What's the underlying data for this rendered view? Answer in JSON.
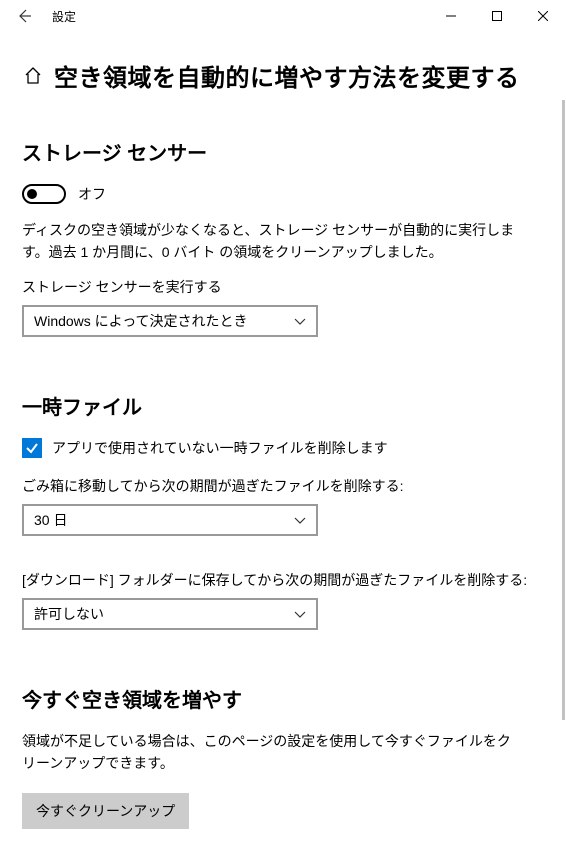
{
  "titlebar": {
    "title": "設定"
  },
  "page": {
    "title": "空き領域を自動的に増やす方法を変更する"
  },
  "storage_sense": {
    "heading": "ストレージ センサー",
    "toggle_label": "オフ",
    "description": "ディスクの空き領域が少なくなると、ストレージ センサーが自動的に実行します。過去 1 か月間に、0 バイト の領域をクリーンアップしました。",
    "run_label": "ストレージ センサーを実行する",
    "run_value": "Windows によって決定されたとき"
  },
  "temp_files": {
    "heading": "一時ファイル",
    "checkbox_label": "アプリで使用されていない一時ファイルを削除します",
    "recycle_label": "ごみ箱に移動してから次の期間が過ぎたファイルを削除する:",
    "recycle_value": "30 日",
    "downloads_label": "[ダウンロード] フォルダーに保存してから次の期間が過ぎたファイルを削除する:",
    "downloads_value": "許可しない"
  },
  "free_now": {
    "heading": "今すぐ空き領域を増やす",
    "description": "領域が不足している場合は、このページの設定を使用して今すぐファイルをクリーンアップできます。",
    "button": "今すぐクリーンアップ"
  }
}
